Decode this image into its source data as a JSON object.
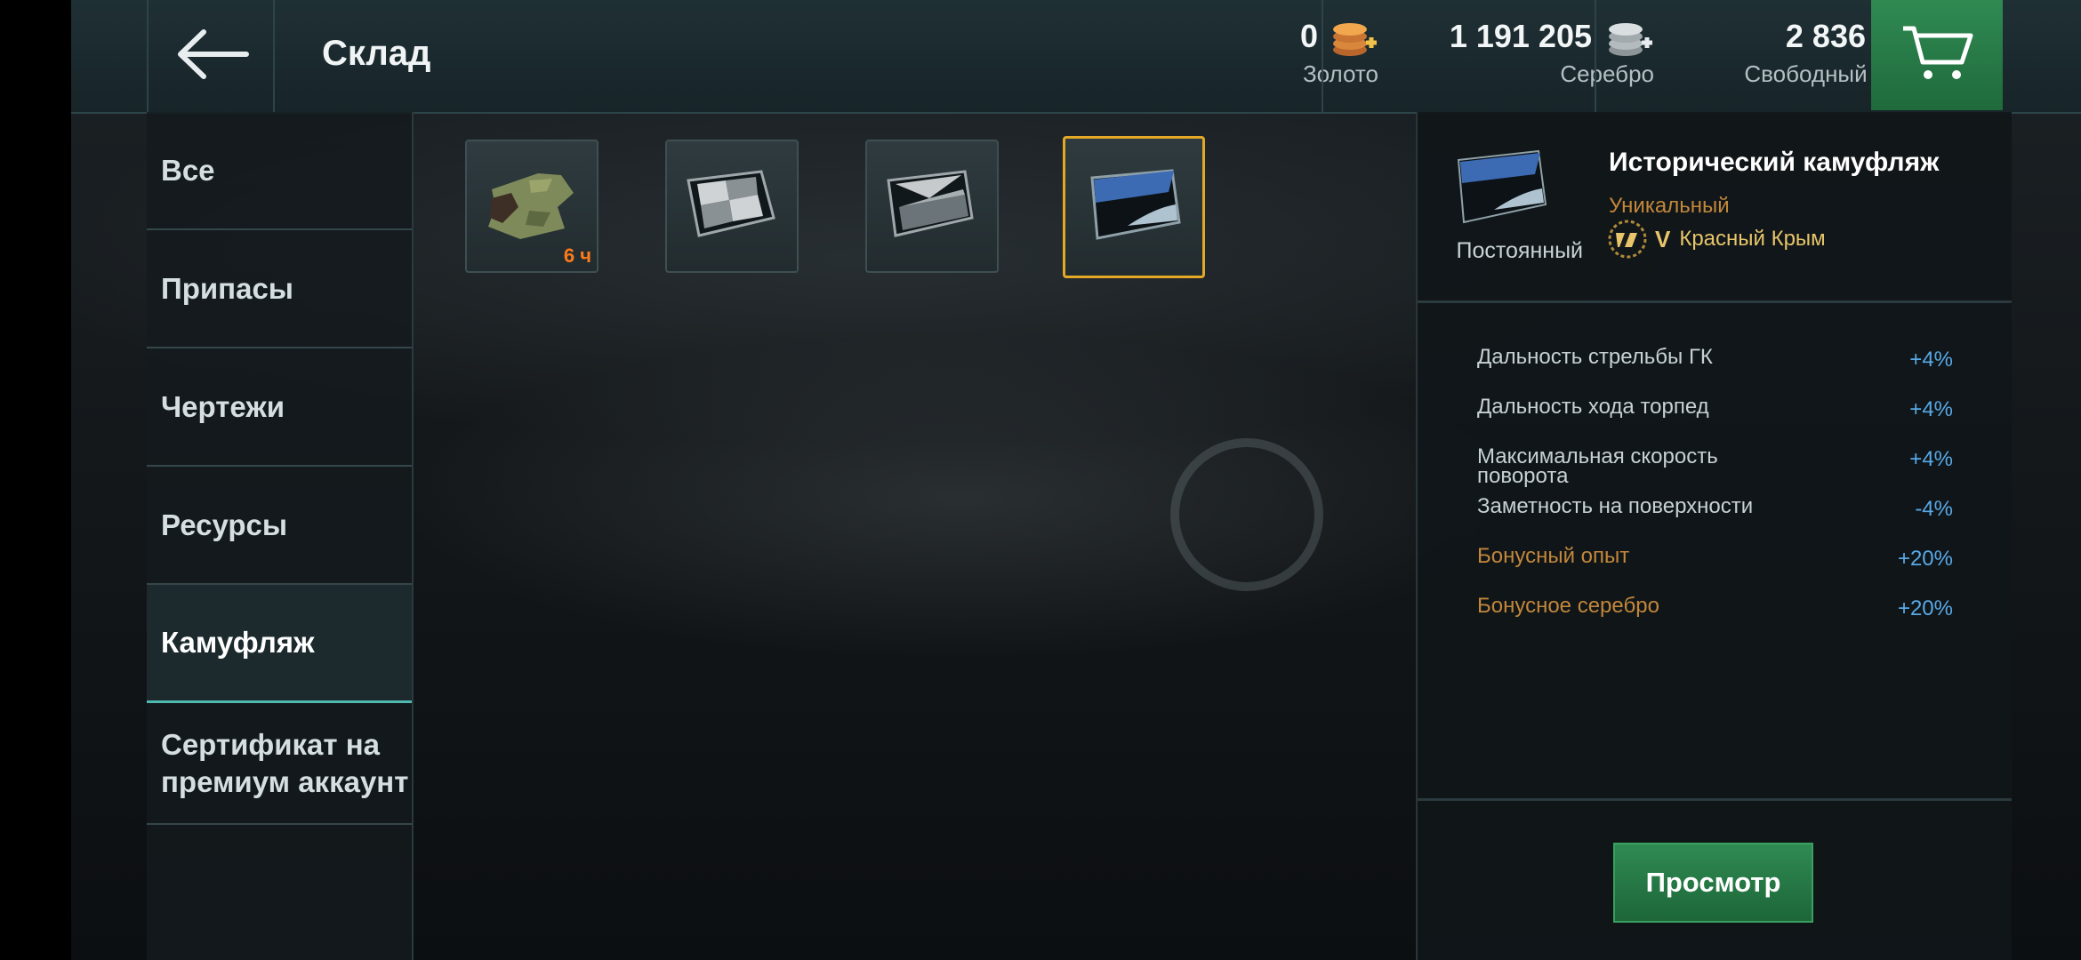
{
  "header": {
    "title": "Склад",
    "gold": {
      "value": "0",
      "label": "Золото"
    },
    "silver": {
      "value": "1 191 205",
      "label": "Серебро"
    },
    "free_xp": {
      "value": "2 836",
      "label": "Свободный опыт"
    },
    "icons": [
      "back-arrow-icon",
      "gold-coins-icon",
      "silver-coins-icon",
      "free-xp-star-icon",
      "cart-icon"
    ]
  },
  "sidebar": {
    "items": [
      {
        "label": "Все"
      },
      {
        "label": "Припасы"
      },
      {
        "label": "Чертежи"
      },
      {
        "label": "Ресурсы"
      },
      {
        "label": "Камуфляж",
        "active": true
      },
      {
        "label": "Сертификат на премиум аккаунт"
      }
    ]
  },
  "items": [
    {
      "name": "camo-green",
      "timer": "6 ч"
    },
    {
      "name": "camo-grey-checker"
    },
    {
      "name": "camo-grey-dark"
    },
    {
      "name": "camo-historical-blue",
      "selected": true
    }
  ],
  "detail": {
    "name": "Исторический камуфляж",
    "rarity": "Уникальный",
    "permanence": "Постоянный",
    "tier": "V",
    "ship": "Красный Крым",
    "bonuses": [
      {
        "name": "Дальность стрельбы ГК",
        "value": "+4%"
      },
      {
        "name": "Дальность хода торпед",
        "value": "+4%"
      },
      {
        "name": "Максимальная скорость поворота",
        "value": "+4%"
      },
      {
        "name": "Заметность на поверхности",
        "value": "-4%"
      },
      {
        "name": "Бонусный опыт",
        "value": "+20%",
        "economic": true
      },
      {
        "name": "Бонусное серебро",
        "value": "+20%",
        "economic": true
      }
    ],
    "view_button": "Просмотр"
  },
  "colors": {
    "header": "#1f3035",
    "accent_green": "#2f8a52",
    "selection": "#e3a825",
    "bonus_value": "#58a9e6",
    "economic_bonus": "#c2873a",
    "timer": "#ff7a1a"
  }
}
